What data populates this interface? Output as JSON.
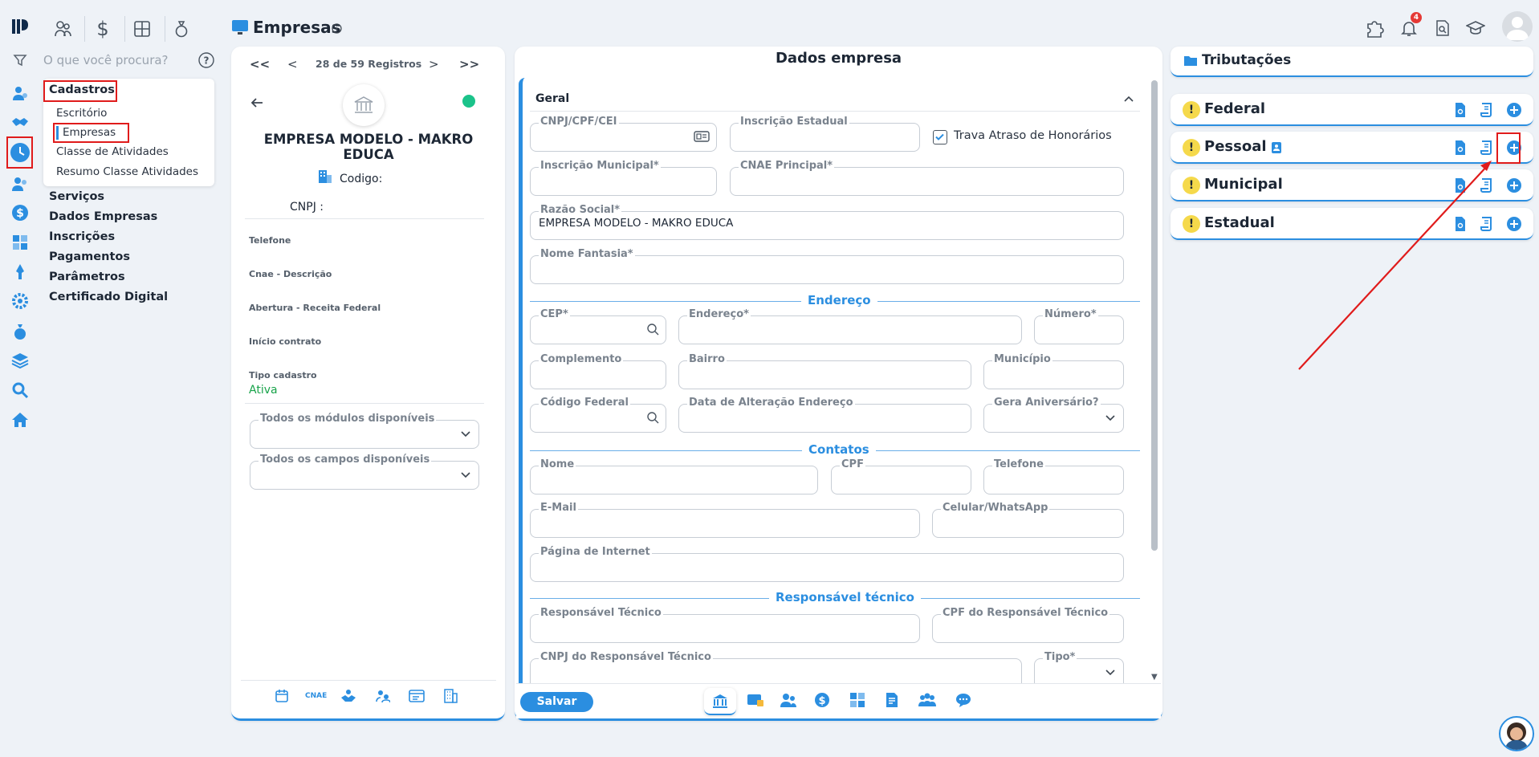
{
  "app": {
    "logo": "logo-icon"
  },
  "top_nav": {
    "icons": [
      "people-icon",
      "dollar-icon",
      "calculator-icon",
      "money-bag-icon"
    ],
    "page_title": "Empresas",
    "notification_count": "4"
  },
  "sidebar": {
    "search_placeholder": "O que você procura?",
    "sections": [
      {
        "label": "Cadastros"
      },
      {
        "label": "Serviços"
      },
      {
        "label": "Dados Empresas"
      },
      {
        "label": "Inscrições"
      },
      {
        "label": "Pagamentos"
      },
      {
        "label": "Parâmetros"
      },
      {
        "label": "Certificado Digital"
      }
    ],
    "submenu": [
      "Escritório",
      "Empresas",
      "Classe de Atividades",
      "Resumo Classe Atividades"
    ]
  },
  "record_panel": {
    "nav_first": "<<",
    "nav_prev": "<",
    "counter": "28 de 59 Registros",
    "nav_next": ">",
    "nav_last": ">>",
    "company_name": "EMPRESA MODELO - MAKRO EDUCA",
    "codigo_label": "Codigo:",
    "cnpj_label": "CNPJ :",
    "telefone_label": "Telefone",
    "cnae_label": "Cnae - Descrição",
    "abertura_label": "Abertura - Receita Federal",
    "inicio_label": "Início contrato",
    "tipo_label": "Tipo cadastro",
    "tipo_value": "Ativa",
    "modulos_label": "Todos os módulos disponíveis",
    "campos_label": "Todos os campos disponíveis",
    "bottom_icons": [
      "calendar-icon",
      "CNAE",
      "handshake-icon",
      "people-swap-icon",
      "card-icon",
      "building-icon"
    ]
  },
  "form": {
    "title": "Dados empresa",
    "group": "Geral",
    "fields": {
      "cnpj": "CNPJ/CPF/CEI",
      "insc_estadual": "Inscrição Estadual",
      "trava": "Trava Atraso de Honorários",
      "insc_municipal": "Inscrição Municipal*",
      "cnae": "CNAE Principal*",
      "razao": "Razão Social*",
      "razao_value": "EMPRESA MODELO  - MAKRO EDUCA",
      "fantasia": "Nome Fantasia*",
      "cep": "CEP*",
      "endereco": "Endereço*",
      "numero": "Número*",
      "complemento": "Complemento",
      "bairro": "Bairro",
      "municipio": "Município",
      "cod_federal": "Código Federal",
      "data_alt": "Data de Alteração Endereço",
      "gera_aniv": "Gera Aniversário?",
      "nome": "Nome",
      "cpf": "CPF",
      "telefone": "Telefone",
      "email": "E-Mail",
      "celular": "Celular/WhatsApp",
      "pagina": "Página de Internet",
      "resp_tec": "Responsável Técnico",
      "cpf_resp": "CPF do Responsável Técnico",
      "cnpj_resp": "CNPJ do Responsável Técnico",
      "tipo": "Tipo*"
    },
    "sections": {
      "endereco": "Endereço",
      "contatos": "Contatos",
      "resp": "Responsável técnico"
    },
    "save_label": "Salvar",
    "bottom_tabs": [
      "bank-icon",
      "card-lock-icon",
      "people-icon",
      "dollar-icon",
      "calculator-icon",
      "document-edit-icon",
      "group-icon",
      "chat-icon"
    ]
  },
  "tributacoes": {
    "title": "Tributações",
    "items": [
      {
        "label": "Federal"
      },
      {
        "label": "Pessoal"
      },
      {
        "label": "Municipal"
      },
      {
        "label": "Estadual"
      }
    ]
  },
  "colors": {
    "accent": "#2b8ee0",
    "highlight": "#e01b1b",
    "active": "#18a34a"
  }
}
